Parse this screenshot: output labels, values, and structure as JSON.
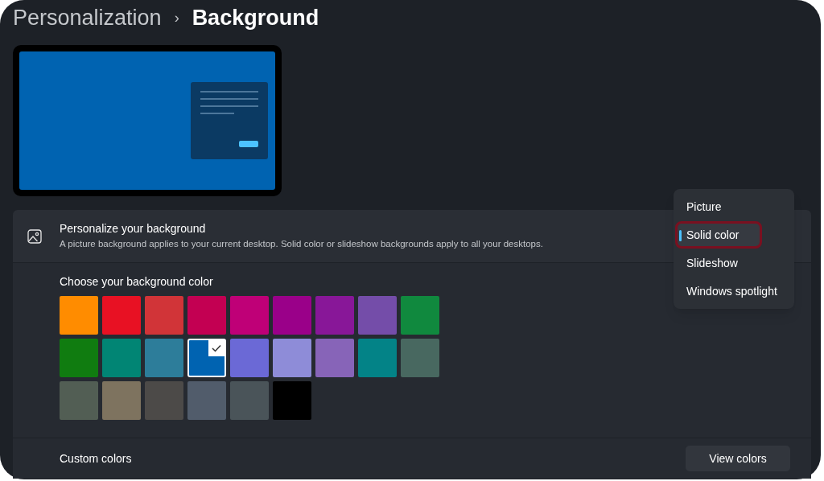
{
  "breadcrumb": {
    "parent": "Personalization",
    "separator": "›",
    "current": "Background"
  },
  "background_setting": {
    "title": "Personalize your background",
    "description": "A picture background applies to your current desktop. Solid color or slideshow backgrounds apply to all your desktops."
  },
  "dropdown": [
    {
      "label": "Picture",
      "selected": false,
      "outlined": false
    },
    {
      "label": "Solid color",
      "selected": true,
      "outlined": true
    },
    {
      "label": "Slideshow",
      "selected": false,
      "outlined": false
    },
    {
      "label": "Windows spotlight",
      "selected": false,
      "outlined": false
    }
  ],
  "color_section": {
    "title": "Choose your background color",
    "swatches": [
      {
        "color": "#ff8c00",
        "selected": false
      },
      {
        "color": "#e81123",
        "selected": false
      },
      {
        "color": "#d13438",
        "selected": false
      },
      {
        "color": "#c30052",
        "selected": false
      },
      {
        "color": "#bf0077",
        "selected": false
      },
      {
        "color": "#9a0089",
        "selected": false
      },
      {
        "color": "#881798",
        "selected": false
      },
      {
        "color": "#744da9",
        "selected": false
      },
      {
        "color": "#10893e",
        "selected": false
      },
      {
        "color": "#107c10",
        "selected": false
      },
      {
        "color": "#018574",
        "selected": false
      },
      {
        "color": "#2d7d9a",
        "selected": false
      },
      {
        "color": "#0063b1",
        "selected": true
      },
      {
        "color": "#6b69d6",
        "selected": false
      },
      {
        "color": "#8e8cd8",
        "selected": false
      },
      {
        "color": "#8764b8",
        "selected": false
      },
      {
        "color": "#038387",
        "selected": false
      },
      {
        "color": "#486860",
        "selected": false
      },
      {
        "color": "#525e54",
        "selected": false
      },
      {
        "color": "#7e735f",
        "selected": false
      },
      {
        "color": "#4c4a48",
        "selected": false
      },
      {
        "color": "#515c6b",
        "selected": false
      },
      {
        "color": "#4a5459",
        "selected": false
      },
      {
        "color": "#000000",
        "selected": false
      }
    ]
  },
  "custom_colors": {
    "label": "Custom colors",
    "button": "View colors"
  }
}
